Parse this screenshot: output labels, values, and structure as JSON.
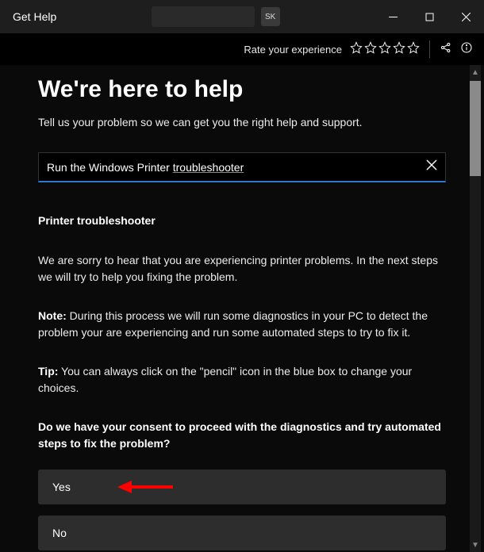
{
  "titlebar": {
    "app_title": "Get Help",
    "avatar_initials": "SK"
  },
  "toolbar": {
    "rate_label": "Rate your experience"
  },
  "main": {
    "heading": "We're here to help",
    "subtitle": "Tell us your problem so we can get you the right help and support.",
    "search_plain": "Run the Windows Printer ",
    "search_underlined": "troubleshooter",
    "section_heading": "Printer troubleshooter",
    "para1": "We are sorry to hear that you are experiencing printer problems. In the next steps we will try to help you fixing the problem.",
    "note_label": "Note:",
    "note_body": " During this process we will run some diagnostics in your PC to detect the problem your are experiencing and run some automated steps to try to fix it.",
    "tip_label": "Tip:",
    "tip_body": " You can always click on the \"pencil\" icon in the blue box to change your choices.",
    "consent_question": "Do we have your consent to proceed with the diagnostics and try automated steps to fix the problem?",
    "option_yes": "Yes",
    "option_no": "No"
  }
}
